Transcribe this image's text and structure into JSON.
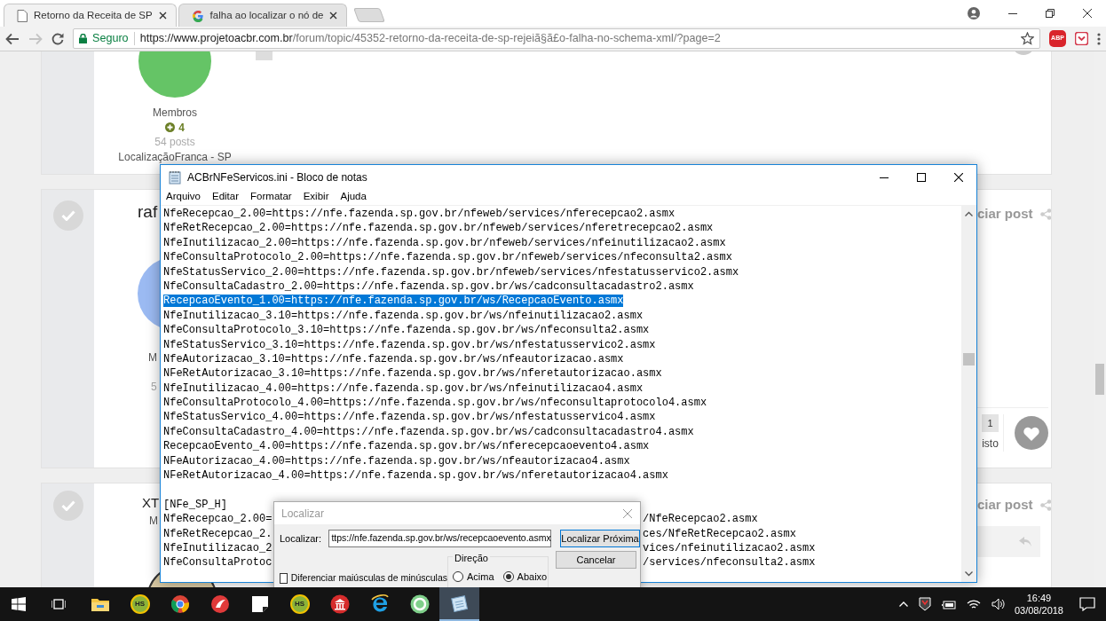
{
  "browser": {
    "tabs": [
      {
        "title": "Retorno da Receita de SP",
        "selected": true
      },
      {
        "title": "falha ao localizar o nó de",
        "selected": false
      }
    ],
    "nav": {
      "back_enabled": true,
      "forward_enabled": false
    },
    "address": {
      "security": "Seguro",
      "host": "https://www.projetoacbr.com.br",
      "path": "/forum/topic/45352-retorno-da-receita-de-sp-rejeiã§ã£o-falha-no-schema-xml/?page=2"
    },
    "extensions": [
      {
        "kind": "adblock",
        "label": "ABP"
      },
      {
        "kind": "pocket"
      }
    ]
  },
  "forum": {
    "first_post": {
      "group": "Membros",
      "reputation": "4",
      "posts": "54 posts",
      "location": "LocalizaçãoFranca - SP"
    },
    "posts": [
      {
        "kind": "reacted",
        "author": "raf",
        "group": "M",
        "posts": "5",
        "report": "ciar post",
        "reactions": {
          "count": "1",
          "label": "isto"
        }
      },
      {
        "kind": "quoted",
        "author": "XT",
        "group": "M",
        "report": "ciar post"
      }
    ]
  },
  "notepad": {
    "title": "ACBrNFeServicos.ini - Bloco de notas",
    "menu": [
      "Arquivo",
      "Editar",
      "Formatar",
      "Exibir",
      "Ajuda"
    ],
    "lines": [
      {
        "kind": "line",
        "selected": false,
        "text": "NfeRecepcao_2.00=https://nfe.fazenda.sp.gov.br/nfeweb/services/nferecepcao2.asmx"
      },
      {
        "kind": "line",
        "selected": false,
        "text": "NfeRetRecepcao_2.00=https://nfe.fazenda.sp.gov.br/nfeweb/services/nferetrecepcao2.asmx"
      },
      {
        "kind": "line",
        "selected": false,
        "text": "NfeInutilizacao_2.00=https://nfe.fazenda.sp.gov.br/nfeweb/services/nfeinutilizacao2.asmx"
      },
      {
        "kind": "line",
        "selected": false,
        "text": "NfeConsultaProtocolo_2.00=https://nfe.fazenda.sp.gov.br/nfeweb/services/nfeconsulta2.asmx"
      },
      {
        "kind": "line",
        "selected": false,
        "text": "NfeStatusServico_2.00=https://nfe.fazenda.sp.gov.br/nfeweb/services/nfestatusservico2.asmx"
      },
      {
        "kind": "line",
        "selected": false,
        "text": "NfeConsultaCadastro_2.00=https://nfe.fazenda.sp.gov.br/ws/cadconsultacadastro2.asmx"
      },
      {
        "kind": "line",
        "selected": true,
        "text": "RecepcaoEvento_1.00=https://nfe.fazenda.sp.gov.br/ws/RecepcaoEvento.asmx"
      },
      {
        "kind": "line",
        "selected": false,
        "text": "NfeInutilizacao_3.10=https://nfe.fazenda.sp.gov.br/ws/nfeinutilizacao2.asmx"
      },
      {
        "kind": "line",
        "selected": false,
        "text": "NfeConsultaProtocolo_3.10=https://nfe.fazenda.sp.gov.br/ws/nfeconsulta2.asmx"
      },
      {
        "kind": "line",
        "selected": false,
        "text": "NfeStatusServico_3.10=https://nfe.fazenda.sp.gov.br/ws/nfestatusservico2.asmx"
      },
      {
        "kind": "line",
        "selected": false,
        "text": "NfeAutorizacao_3.10=https://nfe.fazenda.sp.gov.br/ws/nfeautorizacao.asmx"
      },
      {
        "kind": "line",
        "selected": false,
        "text": "NFeRetAutorizacao_3.10=https://nfe.fazenda.sp.gov.br/ws/nferetautorizacao.asmx"
      },
      {
        "kind": "line",
        "selected": false,
        "text": "NfeInutilizacao_4.00=https://nfe.fazenda.sp.gov.br/ws/nfeinutilizacao4.asmx"
      },
      {
        "kind": "line",
        "selected": false,
        "text": "NfeConsultaProtocolo_4.00=https://nfe.fazenda.sp.gov.br/ws/nfeconsultaprotocolo4.asmx"
      },
      {
        "kind": "line",
        "selected": false,
        "text": "NfeStatusServico_4.00=https://nfe.fazenda.sp.gov.br/ws/nfestatusservico4.asmx"
      },
      {
        "kind": "line",
        "selected": false,
        "text": "NfeConsultaCadastro_4.00=https://nfe.fazenda.sp.gov.br/ws/cadconsultacadastro4.asmx"
      },
      {
        "kind": "line",
        "selected": false,
        "text": "RecepcaoEvento_4.00=https://nfe.fazenda.sp.gov.br/ws/nferecepcaoevento4.asmx"
      },
      {
        "kind": "line",
        "selected": false,
        "text": "NFeAutorizacao_4.00=https://nfe.fazenda.sp.gov.br/ws/nfeautorizacao4.asmx"
      },
      {
        "kind": "line",
        "selected": false,
        "text": "NFeRetAutorizacao_4.00=https://nfe.fazenda.sp.gov.br/ws/nferetautorizacao4.asmx"
      },
      {
        "kind": "blank"
      },
      {
        "kind": "line",
        "selected": false,
        "text": "[NFe_SP_H]"
      },
      {
        "kind": "split",
        "selected": false,
        "left": "NfeRecepcao_2.00=",
        "right": "/NfeRecepcao2.asmx"
      },
      {
        "kind": "split",
        "selected": false,
        "left": "NfeRetRecepcao_2.",
        "right": "ces/NfeRetRecepcao2.asmx"
      },
      {
        "kind": "split",
        "selected": false,
        "left": "NfeInutilizacao_2",
        "right": "vices/nfeinutilizacao2.asmx"
      },
      {
        "kind": "split",
        "selected": false,
        "left": "NfeConsultaProtoc",
        "right": "/services/nfeconsulta2.asmx"
      }
    ]
  },
  "find": {
    "title": "Localizar",
    "label": "Localizar:",
    "value": "ttps://nfe.fazenda.sp.gov.br/ws/recepcaoevento.asmx",
    "buttons": [
      "Localizar Próxima",
      "Cancelar"
    ],
    "direction": {
      "label": "Direção",
      "options": [
        {
          "label": "Acima",
          "selected": false
        },
        {
          "label": "Abaixo",
          "selected": true
        }
      ]
    },
    "match_case": {
      "label": "Diferenciar maiúsculas de minúsculas",
      "checked": false
    }
  },
  "taskbar": {
    "apps": [
      {
        "kind": "explorer",
        "active": false
      },
      {
        "kind": "hs",
        "label": "HS",
        "active": false
      },
      {
        "kind": "browser",
        "active": false
      },
      {
        "kind": "red",
        "active": false
      },
      {
        "kind": "note",
        "active": false
      },
      {
        "kind": "hs",
        "label": "HS",
        "active": false
      },
      {
        "kind": "building",
        "active": false
      },
      {
        "kind": "ie",
        "active": false
      },
      {
        "kind": "green",
        "active": false
      },
      {
        "kind": "notepad",
        "active": true
      }
    ],
    "clock": {
      "time": "16:49",
      "date": "03/08/2018"
    }
  }
}
